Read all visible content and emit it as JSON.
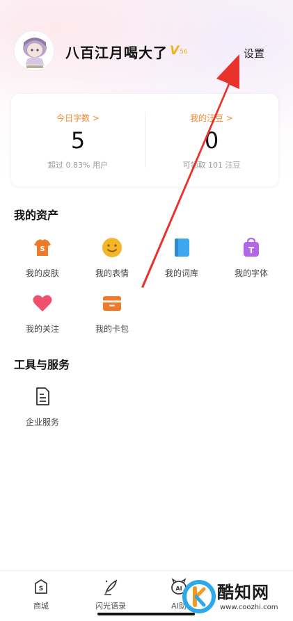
{
  "header": {
    "username": "八百江月喝大了",
    "vip_level": "V",
    "vip_sub": "56",
    "settings_label": "设置"
  },
  "stats": {
    "today_words": {
      "label": "今日字数 >",
      "value": "5",
      "sub": "超过 0.83% 用户"
    },
    "beans": {
      "label": "我的汪豆 >",
      "value": "0",
      "sub": "可领取 101 汪豆"
    }
  },
  "assets": {
    "title": "我的资产",
    "items": [
      {
        "label": "我的皮肤",
        "icon": "skin-icon",
        "color": "#f07a2b"
      },
      {
        "label": "我的表情",
        "icon": "emoji-icon",
        "color": "#f5b52a"
      },
      {
        "label": "我的词库",
        "icon": "lexicon-icon",
        "color": "#3ea6ee"
      },
      {
        "label": "我的字体",
        "icon": "font-icon",
        "color": "#b366e6"
      },
      {
        "label": "我的关注",
        "icon": "heart-icon",
        "color": "#f0506e"
      },
      {
        "label": "我的卡包",
        "icon": "card-wallet-icon",
        "color": "#f07a2b"
      }
    ]
  },
  "tools": {
    "title": "工具与服务",
    "items": [
      {
        "label": "企业服务",
        "icon": "document-icon"
      }
    ]
  },
  "bottom_nav": {
    "items": [
      {
        "label": "商城",
        "icon": "store-icon"
      },
      {
        "label": "闪光语录",
        "icon": "quill-icon"
      },
      {
        "label": "AI助",
        "icon": "ai-icon"
      }
    ]
  },
  "watermark": {
    "brand": "酷知网",
    "url": "www.coozhi.com"
  },
  "colors": {
    "accent_orange": "#ef8a2e",
    "annotation_red": "#e8322b",
    "vip_gold": "#f2b01e"
  }
}
